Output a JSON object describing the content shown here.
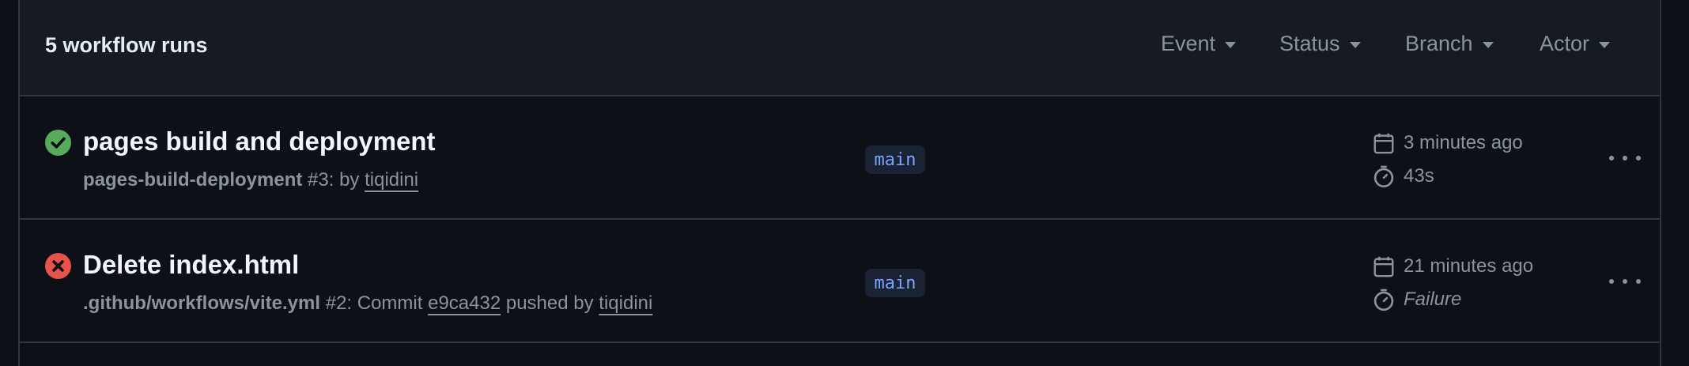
{
  "header": {
    "run_count": "5 workflow runs",
    "filters": [
      "Event",
      "Status",
      "Branch",
      "Actor"
    ]
  },
  "runs": [
    {
      "status": "success",
      "status_color": "#3fb950",
      "title": "pages build and deployment",
      "workflow": "pages-build-deployment",
      "run_number": "#3: by",
      "actor": "tiqidini",
      "branch": "main",
      "time_ago": "3 minutes ago",
      "duration": "43s"
    },
    {
      "status": "failure",
      "status_color": "#da3633",
      "title": "Delete index.html",
      "workflow": ".github/workflows/vite.yml",
      "run_number": "#2: Commit",
      "commit": "e9ca432",
      "pushed_by": "pushed by",
      "actor": "tiqidini",
      "branch": "main",
      "time_ago": "21 minutes ago",
      "duration": "Failure"
    }
  ]
}
